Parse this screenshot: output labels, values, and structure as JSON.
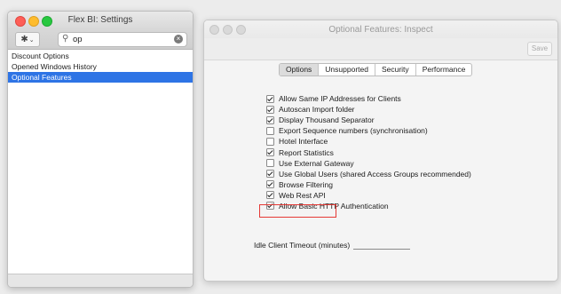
{
  "left_window": {
    "title": "Flex BI: Settings",
    "search_value": "op",
    "items": [
      {
        "label": "Discount Options",
        "selected": false
      },
      {
        "label": "Opened Windows History",
        "selected": false
      },
      {
        "label": "Optional Features",
        "selected": true
      }
    ]
  },
  "right_window": {
    "title": "Optional Features: Inspect",
    "save_label": "Save",
    "tabs": [
      {
        "label": "Options",
        "active": true
      },
      {
        "label": "Unsupported",
        "active": false
      },
      {
        "label": "Security",
        "active": false
      },
      {
        "label": "Performance",
        "active": false
      }
    ],
    "options": [
      {
        "label": "Allow Same IP Addresses for Clients",
        "checked": true
      },
      {
        "label": "Autoscan Import folder",
        "checked": true
      },
      {
        "label": "Display Thousand Separator",
        "checked": true
      },
      {
        "label": "Export Sequence numbers (synchronisation)",
        "checked": false
      },
      {
        "label": "Hotel Interface",
        "checked": false
      },
      {
        "label": "Report Statistics",
        "checked": true
      },
      {
        "label": "Use External Gateway",
        "checked": false
      },
      {
        "label": "Use Global Users (shared Access Groups recommended)",
        "checked": true
      },
      {
        "label": "Browse Filtering",
        "checked": true
      },
      {
        "label": "Web Rest API",
        "checked": true
      },
      {
        "label": "Allow Basic HTTP Authentication",
        "checked": true
      }
    ],
    "idle_label": "Idle Client Timeout (minutes)",
    "idle_value": ""
  },
  "colors": {
    "selection": "#2e74e5",
    "highlight_box": "#e53935"
  }
}
